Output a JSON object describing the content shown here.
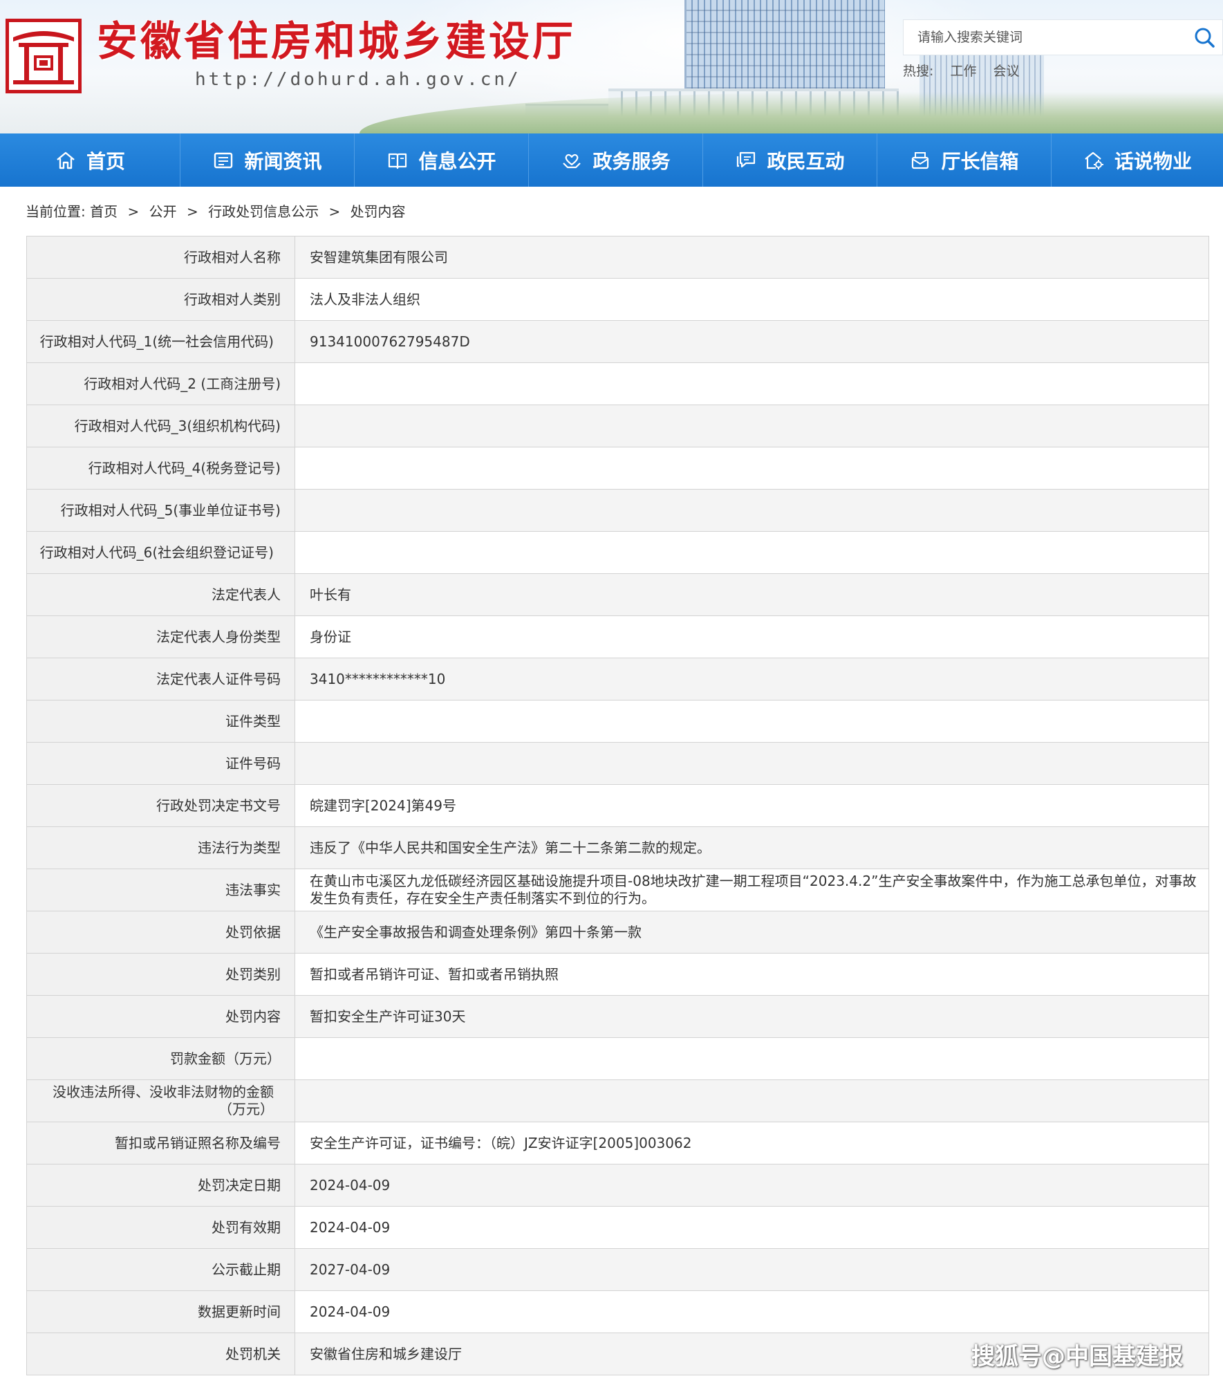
{
  "header": {
    "site_title": "安徽省住房和城乡建设厅",
    "site_url": "http://dohurd.ah.gov.cn/",
    "search_placeholder": "请输入搜索关键词",
    "hot_label": "热搜:",
    "hot_terms": [
      "工作",
      "会议"
    ],
    "brand_color": "#d21920"
  },
  "nav": {
    "items": [
      {
        "label": "首页",
        "icon": "home-icon"
      },
      {
        "label": "新闻资讯",
        "icon": "news-icon"
      },
      {
        "label": "信息公开",
        "icon": "book-icon"
      },
      {
        "label": "政务服务",
        "icon": "service-hands-icon"
      },
      {
        "label": "政民互动",
        "icon": "chat-icon"
      },
      {
        "label": "厅长信箱",
        "icon": "mailbox-icon"
      },
      {
        "label": "话说物业",
        "icon": "property-icon"
      }
    ],
    "color": "#1774cf"
  },
  "breadcrumb": {
    "prefix": "当前位置:",
    "items": [
      "首页",
      "公开",
      "行政处罚信息公示",
      "处罚内容"
    ],
    "separator": ">"
  },
  "table": {
    "rows": [
      {
        "label": "行政相对人名称",
        "value": "安智建筑集团有限公司"
      },
      {
        "label": "行政相对人类别",
        "value": "法人及非法人组织"
      },
      {
        "label": "行政相对人代码_1(统一社会信用代码)",
        "value": "91341000762795487D"
      },
      {
        "label": "行政相对人代码_2 (工商注册号)",
        "value": ""
      },
      {
        "label": "行政相对人代码_3(组织机构代码)",
        "value": ""
      },
      {
        "label": "行政相对人代码_4(税务登记号)",
        "value": ""
      },
      {
        "label": "行政相对人代码_5(事业单位证书号)",
        "value": ""
      },
      {
        "label": "行政相对人代码_6(社会组织登记证号)",
        "value": ""
      },
      {
        "label": "法定代表人",
        "value": "叶长有"
      },
      {
        "label": "法定代表人身份类型",
        "value": "身份证"
      },
      {
        "label": "法定代表人证件号码",
        "value": "3410************10"
      },
      {
        "label": "证件类型",
        "value": ""
      },
      {
        "label": "证件号码",
        "value": ""
      },
      {
        "label": "行政处罚决定书文号",
        "value": "皖建罚字[2024]第49号"
      },
      {
        "label": "违法行为类型",
        "value": "违反了《中华人民共和国安全生产法》第二十二条第二款的规定。"
      },
      {
        "label": "违法事实",
        "value": "在黄山市屯溪区九龙低碳经济园区基础设施提升项目-08地块改扩建一期工程项目“2023.4.2”生产安全事故案件中，作为施工总承包单位，对事故发生负有责任，存在安全生产责任制落实不到位的行为。"
      },
      {
        "label": "处罚依据",
        "value": "《生产安全事故报告和调查处理条例》第四十条第一款"
      },
      {
        "label": "处罚类别",
        "value": "暂扣或者吊销许可证、暂扣或者吊销执照"
      },
      {
        "label": "处罚内容",
        "value": "暂扣安全生产许可证30天"
      },
      {
        "label": "罚款金额（万元）",
        "value": ""
      },
      {
        "label": "没收违法所得、没收非法财物的金额（万元）",
        "value": ""
      },
      {
        "label": "暂扣或吊销证照名称及编号",
        "value": "安全生产许可证，证书编号：（皖）JZ安许证字[2005]003062"
      },
      {
        "label": "处罚决定日期",
        "value": "2024-04-09"
      },
      {
        "label": "处罚有效期",
        "value": "2024-04-09"
      },
      {
        "label": "公示截止期",
        "value": "2027-04-09"
      },
      {
        "label": "数据更新时间",
        "value": "2024-04-09"
      },
      {
        "label": "处罚机关",
        "value": "安徽省住房和城乡建设厅"
      }
    ]
  },
  "watermark": "搜狐号@中国基建报"
}
